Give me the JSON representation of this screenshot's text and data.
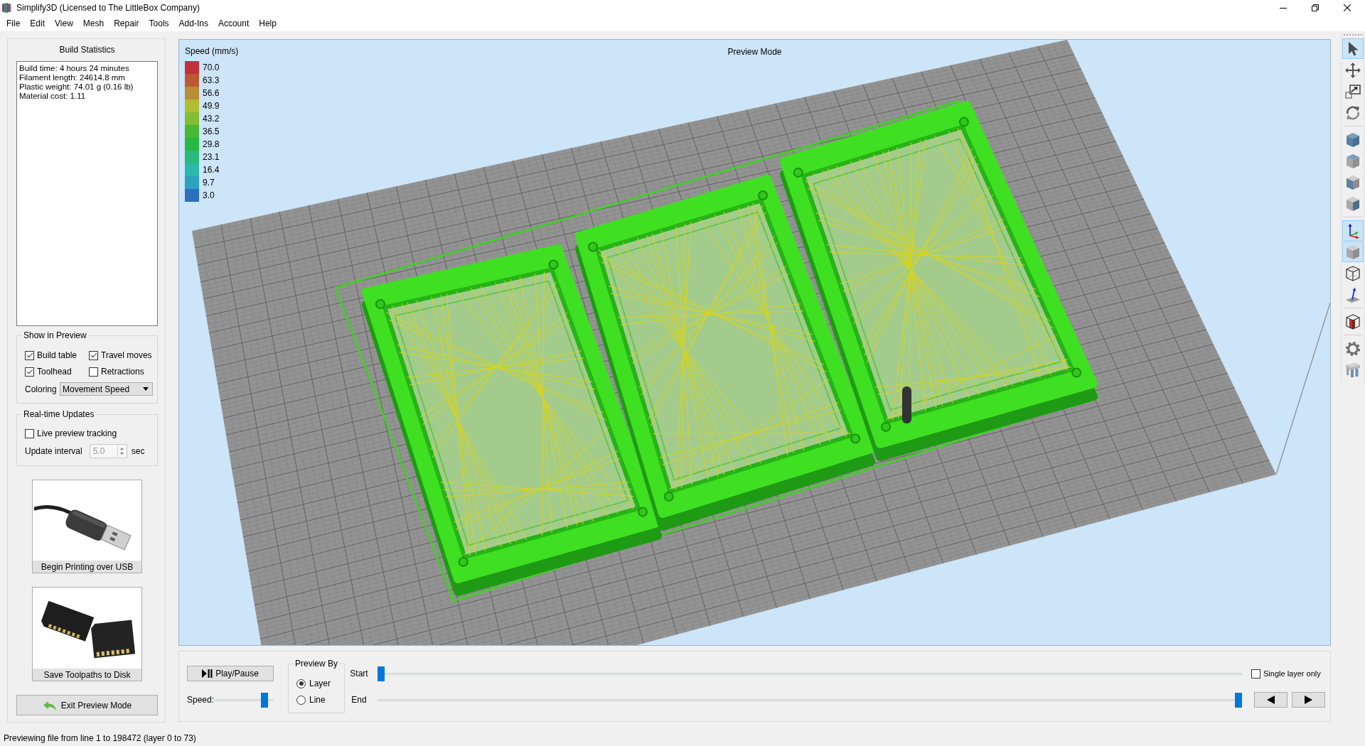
{
  "window": {
    "title": "Simplify3D (Licensed to The LittleBox Company)"
  },
  "menu": [
    "File",
    "Edit",
    "View",
    "Mesh",
    "Repair",
    "Tools",
    "Add-Ins",
    "Account",
    "Help"
  ],
  "build_statistics": {
    "title": "Build Statistics",
    "lines": [
      "Build time: 4 hours 24 minutes",
      "Filament length: 24614.8 mm",
      "Plastic weight: 74.01 g (0.16 lb)",
      "Material cost: 1.11"
    ]
  },
  "show_in_preview": {
    "title": "Show in Preview",
    "options": [
      {
        "label": "Build table",
        "checked": true
      },
      {
        "label": "Travel moves",
        "checked": true
      },
      {
        "label": "Toolhead",
        "checked": true
      },
      {
        "label": "Retractions",
        "checked": false
      }
    ],
    "coloring": {
      "label": "Coloring",
      "value": "Movement Speed"
    }
  },
  "realtime_updates": {
    "title": "Real-time Updates",
    "live_tracking": {
      "label": "Live preview tracking",
      "checked": false
    },
    "update_interval": {
      "label": "Update interval",
      "value": "5.0",
      "unit": "sec",
      "disabled": true
    }
  },
  "actions": [
    {
      "kind": "usb",
      "label": "Begin Printing over USB"
    },
    {
      "kind": "sdcard",
      "label": "Save Toolpaths to Disk"
    }
  ],
  "exit_button": {
    "label": "Exit Preview Mode"
  },
  "viewport": {
    "title": "Preview Mode",
    "legend": {
      "title": "Speed (mm/s)",
      "items": [
        {
          "label": "70.0",
          "color": "#c0313a"
        },
        {
          "label": "63.3",
          "color": "#b85a34"
        },
        {
          "label": "56.6",
          "color": "#b98d35"
        },
        {
          "label": "49.9",
          "color": "#b3bd32"
        },
        {
          "label": "43.2",
          "color": "#84bd35"
        },
        {
          "label": "36.5",
          "color": "#47b935"
        },
        {
          "label": "29.8",
          "color": "#27b943"
        },
        {
          "label": "23.1",
          "color": "#2ab97a"
        },
        {
          "label": "16.4",
          "color": "#2bb9ac"
        },
        {
          "label": "9.7",
          "color": "#2ca1c0"
        },
        {
          "label": "3.0",
          "color": "#2d6fbe"
        }
      ]
    }
  },
  "playback": {
    "play_pause": {
      "label": "Play/Pause"
    },
    "speed": {
      "label": "Speed:",
      "level": 0.89
    },
    "preview_by": {
      "title": "Preview By",
      "options": [
        {
          "label": "Layer",
          "selected": true
        },
        {
          "label": "Line",
          "selected": false
        }
      ]
    },
    "start": {
      "label": "Start",
      "level": 0
    },
    "end": {
      "label": "End",
      "level": 1
    },
    "single_layer": {
      "label": "Single layer only",
      "checked": false
    }
  },
  "toolbar": {
    "groups": [
      {
        "tools": [
          {
            "kind": "select",
            "on": true
          },
          {
            "kind": "move",
            "on": false
          },
          {
            "kind": "scale",
            "on": false
          },
          {
            "kind": "rotate",
            "on": false
          }
        ]
      },
      {
        "tools": [
          {
            "kind": "iso",
            "on": false
          },
          {
            "kind": "top",
            "on": false
          },
          {
            "kind": "front",
            "on": false
          },
          {
            "kind": "side",
            "on": false
          }
        ]
      },
      {
        "tools": [
          {
            "kind": "axes",
            "on": true
          },
          {
            "kind": "solid",
            "on": true
          },
          {
            "kind": "wireframe",
            "on": false
          },
          {
            "kind": "normals",
            "on": false
          }
        ]
      },
      {
        "tools": [
          {
            "kind": "section",
            "on": false
          }
        ]
      },
      {
        "tools": [
          {
            "kind": "settings",
            "on": false
          },
          {
            "kind": "supports",
            "on": false
          }
        ]
      }
    ]
  },
  "status_bar": {
    "text": "Previewing file from line 1 to 198472 (layer 0 to 73)"
  }
}
